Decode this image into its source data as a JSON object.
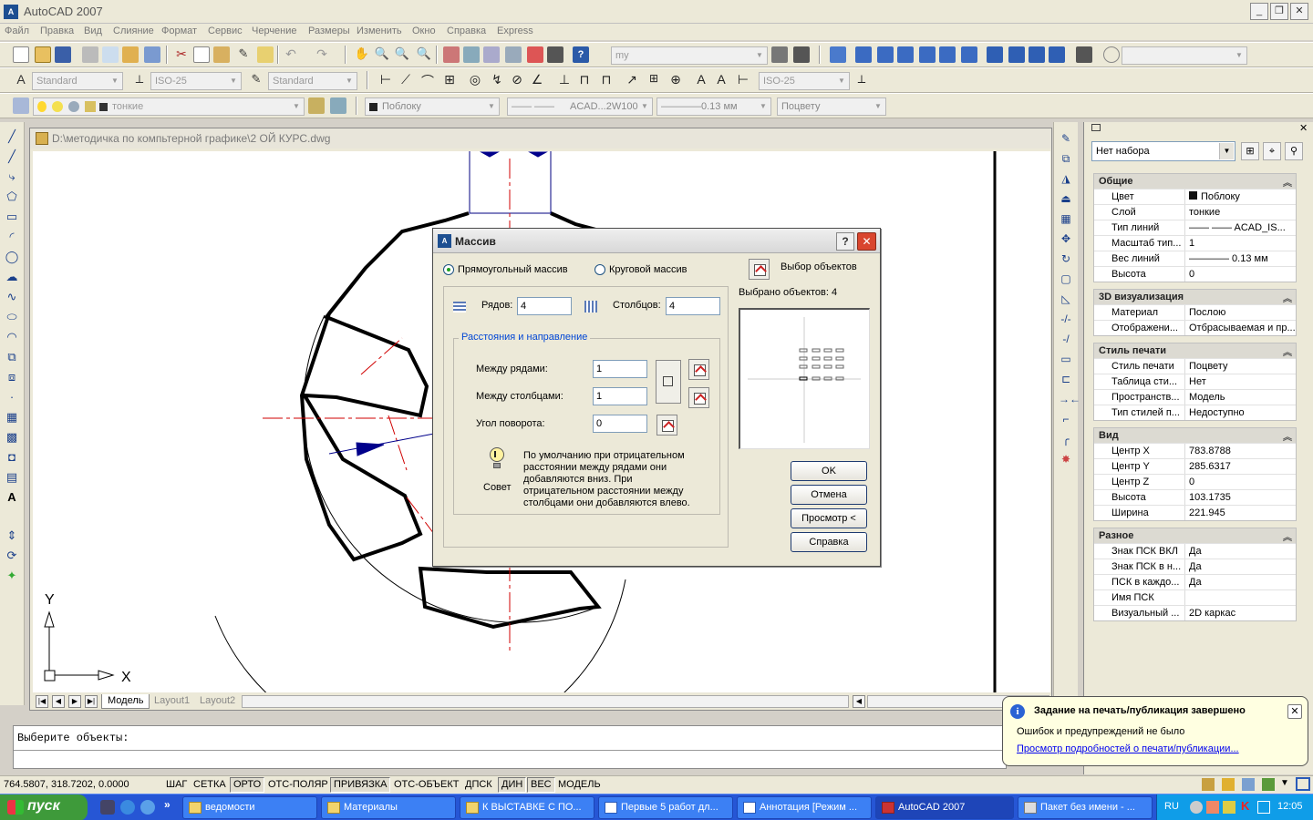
{
  "app": {
    "title": "AutoCAD 2007",
    "icon_text": "A"
  },
  "menu": [
    "Файл",
    "Правка",
    "Вид",
    "Слияние",
    "Формат",
    "Сервис",
    "Черчение",
    "Размеры",
    "Изменить",
    "Окно",
    "Справка",
    "Express"
  ],
  "toolbars": {
    "workspace_combo": "my",
    "text_style": "Standard",
    "dim_style": "ISO-25",
    "table_style": "Standard",
    "dim_style2": "ISO-25",
    "layer": "тонкие",
    "color": "Поблоку",
    "linetype": "ACAD...2W100",
    "lineweight": "0.13 мм",
    "plotstyle": "Поцвету"
  },
  "drawing": {
    "filename": "D:\\методичка по компьтерной графике\\2 ОЙ КУРС.dwg",
    "ucs_x": "X",
    "ucs_y": "Y",
    "tabs": [
      "Модель",
      "Layout1",
      "Layout2"
    ]
  },
  "dialog": {
    "title": "Массив",
    "radio_rect": "Прямоугольный массив",
    "radio_polar": "Круговой массив",
    "select_objects": "Выбор объектов",
    "selected_count": "Выбрано объектов: 4",
    "rows_label": "Рядов:",
    "rows_value": "4",
    "cols_label": "Столбцов:",
    "cols_value": "4",
    "group_title": "Расстояния и направление",
    "row_dist_label": "Между рядами:",
    "row_dist_value": "1",
    "col_dist_label": "Между столбцами:",
    "col_dist_value": "1",
    "angle_label": "Угол поворота:",
    "angle_value": "0",
    "tip_label": "Совет",
    "tip_text": "По умолчанию при отрицательном расстоянии между рядами они добавляются вниз. При отрицательном расстоянии между столбцами они добавляются влево.",
    "btn_ok": "OK",
    "btn_cancel": "Отмена",
    "btn_preview": "Просмотр <",
    "btn_help": "Справка"
  },
  "command": {
    "prompt": "Выберите объекты:"
  },
  "status": {
    "coords": "764.5807, 318.7202, 0.0000",
    "buttons": [
      {
        "label": "ШАГ",
        "on": false
      },
      {
        "label": "СЕТКА",
        "on": false
      },
      {
        "label": "ОРТО",
        "on": true
      },
      {
        "label": "ОТС-ПОЛЯР",
        "on": false
      },
      {
        "label": "ПРИВЯЗКА",
        "on": true
      },
      {
        "label": "ОТС-ОБЪЕКТ",
        "on": false
      },
      {
        "label": "ДПСК",
        "on": false
      },
      {
        "label": "ДИН",
        "on": true
      },
      {
        "label": "ВЕС",
        "on": true
      },
      {
        "label": "МОДЕЛЬ",
        "on": false
      }
    ]
  },
  "properties": {
    "selection": "Нет набора",
    "sections": [
      {
        "title": "Общие",
        "rows": [
          [
            "Цвет",
            "Поблоку"
          ],
          [
            "Слой",
            "тонкие"
          ],
          [
            "Тип линий",
            "—— ——  ACAD_IS..."
          ],
          [
            "Масштаб тип...",
            "1"
          ],
          [
            "Вес линий",
            "————  0.13 мм"
          ],
          [
            "Высота",
            "0"
          ]
        ]
      },
      {
        "title": "3D визуализация",
        "rows": [
          [
            "Материал",
            "Послою"
          ],
          [
            "Отображени...",
            "Отбрасываемая и пр..."
          ]
        ]
      },
      {
        "title": "Стиль печати",
        "rows": [
          [
            "Стиль печати",
            "Поцвету"
          ],
          [
            "Таблица сти...",
            "Нет"
          ],
          [
            "Пространств...",
            "Модель"
          ],
          [
            "Тип стилей п...",
            "Недоступно"
          ]
        ]
      },
      {
        "title": "Вид",
        "rows": [
          [
            "Центр X",
            "783.8788"
          ],
          [
            "Центр Y",
            "285.6317"
          ],
          [
            "Центр Z",
            "0"
          ],
          [
            "Высота",
            "103.1735"
          ],
          [
            "Ширина",
            "221.945"
          ]
        ]
      },
      {
        "title": "Разное",
        "rows": [
          [
            "Знак ПСК ВКЛ",
            "Да"
          ],
          [
            "Знак ПСК в н...",
            "Да"
          ],
          [
            "ПСК в каждо...",
            "Да"
          ],
          [
            "Имя ПСК",
            ""
          ],
          [
            "Визуальный ...",
            "2D каркас"
          ]
        ]
      }
    ]
  },
  "balloon": {
    "title": "Задание на печать/публикация завершено",
    "message": "Ошибок и предупреждений не было",
    "link": "Просмотр подробностей о печати/публикации..."
  },
  "taskbar": {
    "start": "пуск",
    "tasks": [
      "ведомости",
      "Материалы",
      "К ВЫСТАВКЕ С ПО...",
      "Первые 5 работ дл...",
      "Аннотация [Режим ...",
      "AutoCAD 2007",
      "Пакет без имени - ..."
    ],
    "lang": "RU",
    "clock": "12:05"
  },
  "colors": {
    "taskbar": "#2656d5",
    "start": "#3e9a3a",
    "dialog_close": "#d9452e",
    "accent_link": "#0046d5"
  }
}
